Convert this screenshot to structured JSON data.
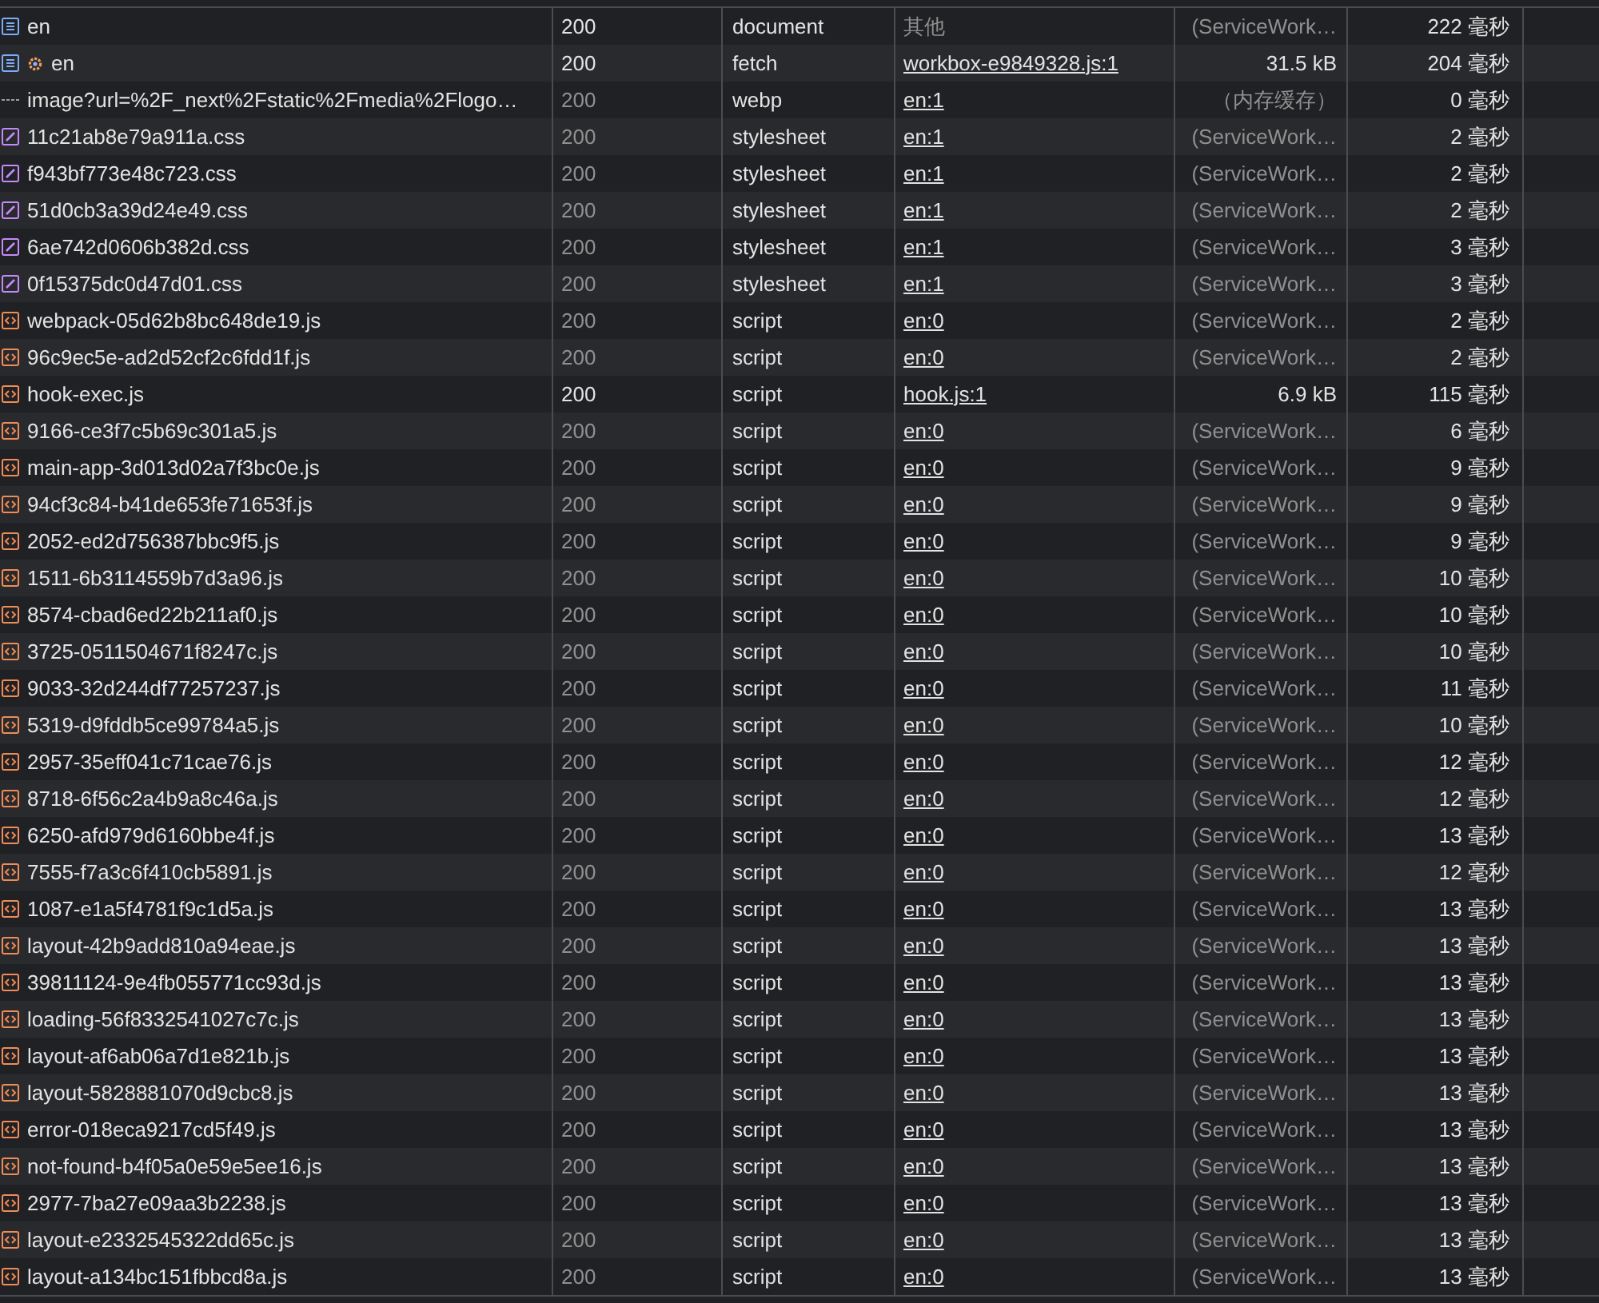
{
  "rows": [
    {
      "name": "en",
      "kind": "doc",
      "service_worker": false,
      "status": "200",
      "status_dim": false,
      "type": "document",
      "initiator": "其他",
      "initiator_link": false,
      "size": "(ServiceWork…",
      "size_dim": true,
      "time": "222 毫秒"
    },
    {
      "name": "en",
      "kind": "doc",
      "service_worker": true,
      "status": "200",
      "status_dim": false,
      "type": "fetch",
      "initiator": "workbox-e9849328.js:1",
      "initiator_link": true,
      "size": "31.5 kB",
      "size_dim": false,
      "time": "204 毫秒"
    },
    {
      "name": "image?url=%2F_next%2Fstatic%2Fmedia%2Flogo…",
      "kind": "img",
      "service_worker": false,
      "status": "200",
      "status_dim": true,
      "type": "webp",
      "initiator": "en:1",
      "initiator_link": true,
      "size": "（内存缓存）",
      "size_dim": true,
      "time": "0 毫秒"
    },
    {
      "name": "11c21ab8e79a911a.css",
      "kind": "css",
      "service_worker": false,
      "status": "200",
      "status_dim": true,
      "type": "stylesheet",
      "initiator": "en:1",
      "initiator_link": true,
      "size": "(ServiceWork…",
      "size_dim": true,
      "time": "2 毫秒"
    },
    {
      "name": "f943bf773e48c723.css",
      "kind": "css",
      "service_worker": false,
      "status": "200",
      "status_dim": true,
      "type": "stylesheet",
      "initiator": "en:1",
      "initiator_link": true,
      "size": "(ServiceWork…",
      "size_dim": true,
      "time": "2 毫秒"
    },
    {
      "name": "51d0cb3a39d24e49.css",
      "kind": "css",
      "service_worker": false,
      "status": "200",
      "status_dim": true,
      "type": "stylesheet",
      "initiator": "en:1",
      "initiator_link": true,
      "size": "(ServiceWork…",
      "size_dim": true,
      "time": "2 毫秒"
    },
    {
      "name": "6ae742d0606b382d.css",
      "kind": "css",
      "service_worker": false,
      "status": "200",
      "status_dim": true,
      "type": "stylesheet",
      "initiator": "en:1",
      "initiator_link": true,
      "size": "(ServiceWork…",
      "size_dim": true,
      "time": "3 毫秒"
    },
    {
      "name": "0f15375dc0d47d01.css",
      "kind": "css",
      "service_worker": false,
      "status": "200",
      "status_dim": true,
      "type": "stylesheet",
      "initiator": "en:1",
      "initiator_link": true,
      "size": "(ServiceWork…",
      "size_dim": true,
      "time": "3 毫秒"
    },
    {
      "name": "webpack-05d62b8bc648de19.js",
      "kind": "js",
      "service_worker": false,
      "status": "200",
      "status_dim": true,
      "type": "script",
      "initiator": "en:0",
      "initiator_link": true,
      "size": "(ServiceWork…",
      "size_dim": true,
      "time": "2 毫秒"
    },
    {
      "name": "96c9ec5e-ad2d52cf2c6fdd1f.js",
      "kind": "js",
      "service_worker": false,
      "status": "200",
      "status_dim": true,
      "type": "script",
      "initiator": "en:0",
      "initiator_link": true,
      "size": "(ServiceWork…",
      "size_dim": true,
      "time": "2 毫秒"
    },
    {
      "name": "hook-exec.js",
      "kind": "js",
      "service_worker": false,
      "status": "200",
      "status_dim": false,
      "type": "script",
      "initiator": "hook.js:1",
      "initiator_link": true,
      "size": "6.9 kB",
      "size_dim": false,
      "time": "115 毫秒"
    },
    {
      "name": "9166-ce3f7c5b69c301a5.js",
      "kind": "js",
      "service_worker": false,
      "status": "200",
      "status_dim": true,
      "type": "script",
      "initiator": "en:0",
      "initiator_link": true,
      "size": "(ServiceWork…",
      "size_dim": true,
      "time": "6 毫秒"
    },
    {
      "name": "main-app-3d013d02a7f3bc0e.js",
      "kind": "js",
      "service_worker": false,
      "status": "200",
      "status_dim": true,
      "type": "script",
      "initiator": "en:0",
      "initiator_link": true,
      "size": "(ServiceWork…",
      "size_dim": true,
      "time": "9 毫秒"
    },
    {
      "name": "94cf3c84-b41de653fe71653f.js",
      "kind": "js",
      "service_worker": false,
      "status": "200",
      "status_dim": true,
      "type": "script",
      "initiator": "en:0",
      "initiator_link": true,
      "size": "(ServiceWork…",
      "size_dim": true,
      "time": "9 毫秒"
    },
    {
      "name": "2052-ed2d756387bbc9f5.js",
      "kind": "js",
      "service_worker": false,
      "status": "200",
      "status_dim": true,
      "type": "script",
      "initiator": "en:0",
      "initiator_link": true,
      "size": "(ServiceWork…",
      "size_dim": true,
      "time": "9 毫秒"
    },
    {
      "name": "1511-6b3114559b7d3a96.js",
      "kind": "js",
      "service_worker": false,
      "status": "200",
      "status_dim": true,
      "type": "script",
      "initiator": "en:0",
      "initiator_link": true,
      "size": "(ServiceWork…",
      "size_dim": true,
      "time": "10 毫秒"
    },
    {
      "name": "8574-cbad6ed22b211af0.js",
      "kind": "js",
      "service_worker": false,
      "status": "200",
      "status_dim": true,
      "type": "script",
      "initiator": "en:0",
      "initiator_link": true,
      "size": "(ServiceWork…",
      "size_dim": true,
      "time": "10 毫秒"
    },
    {
      "name": "3725-0511504671f8247c.js",
      "kind": "js",
      "service_worker": false,
      "status": "200",
      "status_dim": true,
      "type": "script",
      "initiator": "en:0",
      "initiator_link": true,
      "size": "(ServiceWork…",
      "size_dim": true,
      "time": "10 毫秒"
    },
    {
      "name": "9033-32d244df77257237.js",
      "kind": "js",
      "service_worker": false,
      "status": "200",
      "status_dim": true,
      "type": "script",
      "initiator": "en:0",
      "initiator_link": true,
      "size": "(ServiceWork…",
      "size_dim": true,
      "time": "11 毫秒"
    },
    {
      "name": "5319-d9fddb5ce99784a5.js",
      "kind": "js",
      "service_worker": false,
      "status": "200",
      "status_dim": true,
      "type": "script",
      "initiator": "en:0",
      "initiator_link": true,
      "size": "(ServiceWork…",
      "size_dim": true,
      "time": "10 毫秒"
    },
    {
      "name": "2957-35eff041c71cae76.js",
      "kind": "js",
      "service_worker": false,
      "status": "200",
      "status_dim": true,
      "type": "script",
      "initiator": "en:0",
      "initiator_link": true,
      "size": "(ServiceWork…",
      "size_dim": true,
      "time": "12 毫秒"
    },
    {
      "name": "8718-6f56c2a4b9a8c46a.js",
      "kind": "js",
      "service_worker": false,
      "status": "200",
      "status_dim": true,
      "type": "script",
      "initiator": "en:0",
      "initiator_link": true,
      "size": "(ServiceWork…",
      "size_dim": true,
      "time": "12 毫秒"
    },
    {
      "name": "6250-afd979d6160bbe4f.js",
      "kind": "js",
      "service_worker": false,
      "status": "200",
      "status_dim": true,
      "type": "script",
      "initiator": "en:0",
      "initiator_link": true,
      "size": "(ServiceWork…",
      "size_dim": true,
      "time": "13 毫秒"
    },
    {
      "name": "7555-f7a3c6f410cb5891.js",
      "kind": "js",
      "service_worker": false,
      "status": "200",
      "status_dim": true,
      "type": "script",
      "initiator": "en:0",
      "initiator_link": true,
      "size": "(ServiceWork…",
      "size_dim": true,
      "time": "12 毫秒"
    },
    {
      "name": "1087-e1a5f4781f9c1d5a.js",
      "kind": "js",
      "service_worker": false,
      "status": "200",
      "status_dim": true,
      "type": "script",
      "initiator": "en:0",
      "initiator_link": true,
      "size": "(ServiceWork…",
      "size_dim": true,
      "time": "13 毫秒"
    },
    {
      "name": "layout-42b9add810a94eae.js",
      "kind": "js",
      "service_worker": false,
      "status": "200",
      "status_dim": true,
      "type": "script",
      "initiator": "en:0",
      "initiator_link": true,
      "size": "(ServiceWork…",
      "size_dim": true,
      "time": "13 毫秒"
    },
    {
      "name": "39811124-9e4fb055771cc93d.js",
      "kind": "js",
      "service_worker": false,
      "status": "200",
      "status_dim": true,
      "type": "script",
      "initiator": "en:0",
      "initiator_link": true,
      "size": "(ServiceWork…",
      "size_dim": true,
      "time": "13 毫秒"
    },
    {
      "name": "loading-56f8332541027c7c.js",
      "kind": "js",
      "service_worker": false,
      "status": "200",
      "status_dim": true,
      "type": "script",
      "initiator": "en:0",
      "initiator_link": true,
      "size": "(ServiceWork…",
      "size_dim": true,
      "time": "13 毫秒"
    },
    {
      "name": "layout-af6ab06a7d1e821b.js",
      "kind": "js",
      "service_worker": false,
      "status": "200",
      "status_dim": true,
      "type": "script",
      "initiator": "en:0",
      "initiator_link": true,
      "size": "(ServiceWork…",
      "size_dim": true,
      "time": "13 毫秒"
    },
    {
      "name": "layout-5828881070d9cbc8.js",
      "kind": "js",
      "service_worker": false,
      "status": "200",
      "status_dim": true,
      "type": "script",
      "initiator": "en:0",
      "initiator_link": true,
      "size": "(ServiceWork…",
      "size_dim": true,
      "time": "13 毫秒"
    },
    {
      "name": "error-018eca9217cd5f49.js",
      "kind": "js",
      "service_worker": false,
      "status": "200",
      "status_dim": true,
      "type": "script",
      "initiator": "en:0",
      "initiator_link": true,
      "size": "(ServiceWork…",
      "size_dim": true,
      "time": "13 毫秒"
    },
    {
      "name": "not-found-b4f05a0e59e5ee16.js",
      "kind": "js",
      "service_worker": false,
      "status": "200",
      "status_dim": true,
      "type": "script",
      "initiator": "en:0",
      "initiator_link": true,
      "size": "(ServiceWork…",
      "size_dim": true,
      "time": "13 毫秒"
    },
    {
      "name": "2977-7ba27e09aa3b2238.js",
      "kind": "js",
      "service_worker": false,
      "status": "200",
      "status_dim": true,
      "type": "script",
      "initiator": "en:0",
      "initiator_link": true,
      "size": "(ServiceWork…",
      "size_dim": true,
      "time": "13 毫秒"
    },
    {
      "name": "layout-e2332545322dd65c.js",
      "kind": "js",
      "service_worker": false,
      "status": "200",
      "status_dim": true,
      "type": "script",
      "initiator": "en:0",
      "initiator_link": true,
      "size": "(ServiceWork…",
      "size_dim": true,
      "time": "13 毫秒"
    },
    {
      "name": "layout-a134bc151fbbcd8a.js",
      "kind": "js",
      "service_worker": false,
      "status": "200",
      "status_dim": true,
      "type": "script",
      "initiator": "en:0",
      "initiator_link": true,
      "size": "(ServiceWork…",
      "size_dim": true,
      "time": "13 毫秒"
    }
  ]
}
